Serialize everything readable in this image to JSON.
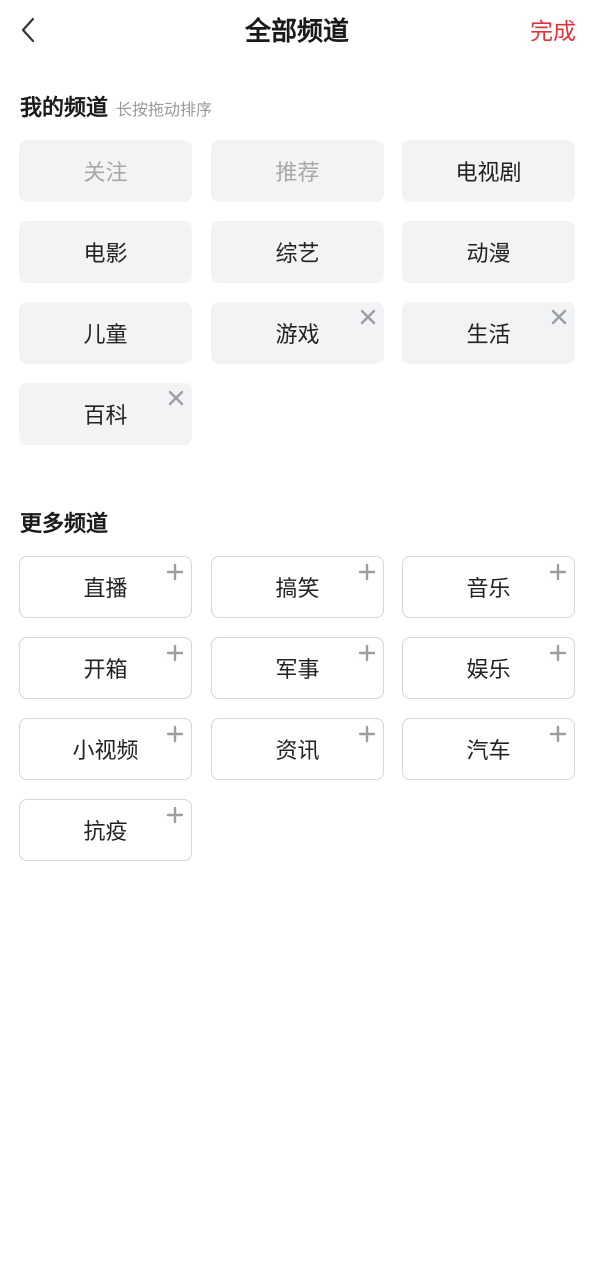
{
  "header": {
    "title": "全部频道",
    "done_label": "完成"
  },
  "my_channels": {
    "title": "我的频道",
    "hint": "长按拖动排序",
    "items": [
      {
        "label": "关注",
        "fixed": true,
        "removable": false
      },
      {
        "label": "推荐",
        "fixed": true,
        "removable": false
      },
      {
        "label": "电视剧",
        "fixed": false,
        "removable": false
      },
      {
        "label": "电影",
        "fixed": false,
        "removable": false
      },
      {
        "label": "综艺",
        "fixed": false,
        "removable": false
      },
      {
        "label": "动漫",
        "fixed": false,
        "removable": false
      },
      {
        "label": "儿童",
        "fixed": false,
        "removable": false
      },
      {
        "label": "游戏",
        "fixed": false,
        "removable": true
      },
      {
        "label": "生活",
        "fixed": false,
        "removable": true
      },
      {
        "label": "百科",
        "fixed": false,
        "removable": true
      }
    ]
  },
  "more_channels": {
    "title": "更多频道",
    "items": [
      {
        "label": "直播"
      },
      {
        "label": "搞笑"
      },
      {
        "label": "音乐"
      },
      {
        "label": "开箱"
      },
      {
        "label": "军事"
      },
      {
        "label": "娱乐"
      },
      {
        "label": "小视频"
      },
      {
        "label": "资讯"
      },
      {
        "label": "汽车"
      },
      {
        "label": "抗疫"
      }
    ]
  },
  "icons": {
    "back": "chevron-left-icon",
    "remove": "close-icon",
    "add": "plus-icon"
  },
  "colors": {
    "accent": "#e2333b",
    "tile_bg": "#f2f3f5",
    "fixed_text": "#a8a8a8",
    "hint_text": "#9a9a9a",
    "border": "#d6d6d6"
  }
}
